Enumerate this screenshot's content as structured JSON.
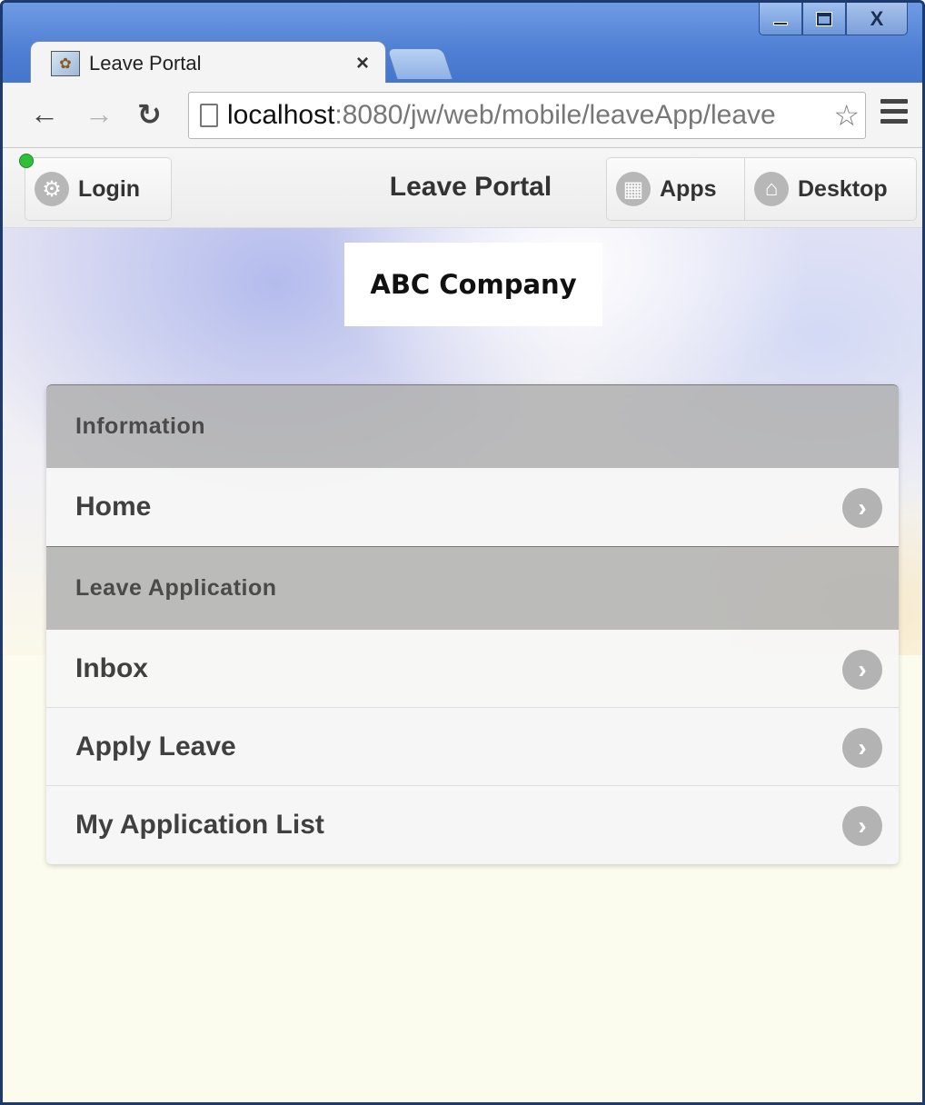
{
  "window": {
    "controls": {
      "close_glyph": "X"
    }
  },
  "browser": {
    "tab": {
      "title": "Leave Portal",
      "close_glyph": "×"
    },
    "url": {
      "host": "localhost",
      "path": ":8080/jw/web/mobile/leaveApp/leave"
    }
  },
  "header": {
    "title": "Leave Portal",
    "login_label": "Login",
    "apps_label": "Apps",
    "desktop_label": "Desktop"
  },
  "logo": {
    "text": "ABC Company"
  },
  "menu": {
    "sections": [
      {
        "heading": "Information",
        "items": [
          "Home"
        ]
      },
      {
        "heading": "Leave Application",
        "items": [
          "Inbox",
          "Apply Leave",
          "My Application List"
        ]
      }
    ]
  },
  "colors": {
    "status_dot": "#2fbf3a",
    "divider_bg": "#b0b0b0",
    "page_bg": "#fcfcee"
  }
}
